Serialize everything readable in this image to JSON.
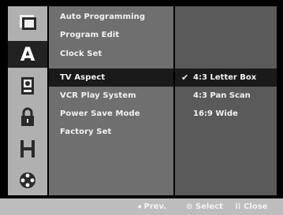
{
  "icons": [
    {
      "name": "disc-icon"
    },
    {
      "name": "language-icon",
      "glyph": "A"
    },
    {
      "name": "media-card-icon"
    },
    {
      "name": "lock-icon"
    },
    {
      "name": "recording-icon"
    },
    {
      "name": "film-reel-icon"
    }
  ],
  "menu": {
    "items": [
      {
        "label": "Auto Programming"
      },
      {
        "label": "Program Edit"
      },
      {
        "label": "Clock Set"
      },
      {
        "label": "TV Aspect",
        "selected": true
      },
      {
        "label": "VCR Play System"
      },
      {
        "label": "Power Save Mode"
      },
      {
        "label": "Factory Set"
      }
    ]
  },
  "options": {
    "items": [
      {
        "label": "4:3 Letter Box",
        "checked": true
      },
      {
        "label": "4:3 Pan Scan"
      },
      {
        "label": "16:9 Wide"
      }
    ],
    "check_glyph": "✔"
  },
  "bottom": {
    "prev": "◂ Prev.",
    "select": "⊙ Select",
    "close": "⁞⁞ Close"
  }
}
